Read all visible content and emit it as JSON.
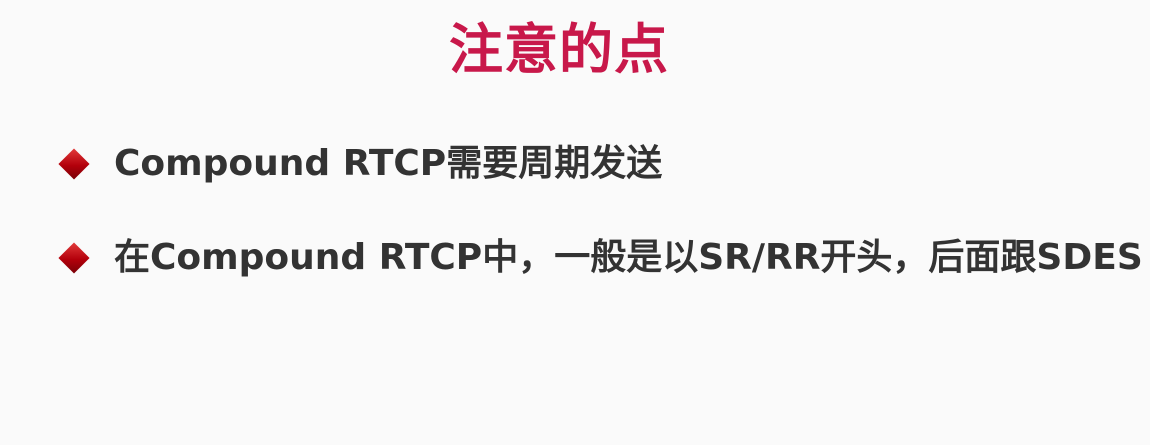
{
  "slide": {
    "title": "注意的点",
    "bullets": [
      {
        "icon": "diamond-bullet-icon",
        "text": "Compound RTCP需要周期发送"
      },
      {
        "icon": "diamond-bullet-icon",
        "text": "在Compound RTCP中，一般是以SR/RR开头，后面跟SDES"
      }
    ]
  },
  "colors": {
    "title": "#c8184a",
    "text": "#333333",
    "bullet": "#b3000b",
    "background": "#fafafa"
  }
}
